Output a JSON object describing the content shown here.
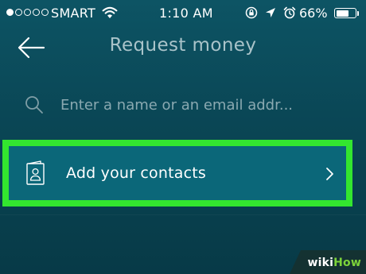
{
  "status_bar": {
    "signal_bars_filled": 1,
    "signal_bars_total": 5,
    "carrier": "SMART",
    "wifi_icon": "wifi-icon",
    "time": "1:10 AM",
    "icons": [
      "orientation-lock-icon",
      "location-arrow-icon",
      "alarm-clock-icon"
    ],
    "battery_percent_label": "66%",
    "battery_level": 0.66
  },
  "header": {
    "back_icon": "arrow-left-icon",
    "title": "Request money"
  },
  "search": {
    "icon": "search-icon",
    "placeholder": "Enter a name or an email addr..."
  },
  "contacts_row": {
    "icon": "contact-card-icon",
    "label": "Add your contacts",
    "chevron_icon": "chevron-right-icon",
    "highlight_color": "#33e62f"
  },
  "colors": {
    "background": "#0a4655",
    "row_background": "#0b6779",
    "title_text": "#a9c3c9",
    "placeholder_text": "#8aa9b1"
  },
  "watermark": {
    "wiki": "wiki",
    "how": "How"
  }
}
